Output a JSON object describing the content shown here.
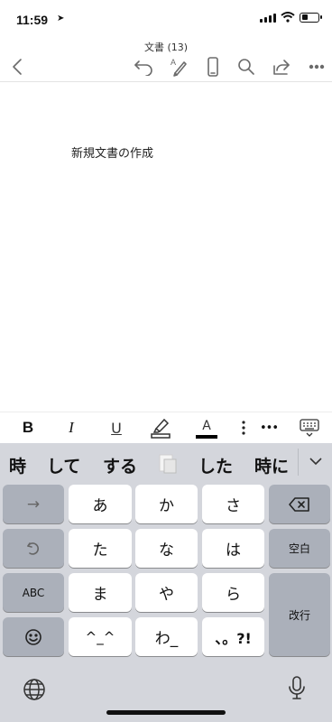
{
  "status": {
    "time": "11:59",
    "location_icon": "location-arrow-icon",
    "battery_level": 0.35
  },
  "document": {
    "title": "文書 (13)",
    "body_text": "新規文書の作成"
  },
  "toolbar": {
    "icons": [
      "back-icon",
      "undo-icon",
      "pen-icon",
      "phone-view-icon",
      "search-icon",
      "share-icon",
      "more-icon"
    ]
  },
  "format_bar": {
    "bold": "B",
    "italic": "I",
    "underline": "U",
    "font_color": "A",
    "more": "•••",
    "font_color_value": "#000000"
  },
  "candidates": [
    "時",
    "して",
    "する",
    "した",
    "時に"
  ],
  "keys": {
    "arrow": "→",
    "a": "あ",
    "ka": "か",
    "sa": "さ",
    "ta": "た",
    "na": "な",
    "ha": "は",
    "space": "空白",
    "abc": "ABC",
    "ma": "ま",
    "ya": "や",
    "ra": "ら",
    "enter": "改行",
    "kaomoji": "^_^",
    "wa": "わ_",
    "punct": "、。?!"
  }
}
